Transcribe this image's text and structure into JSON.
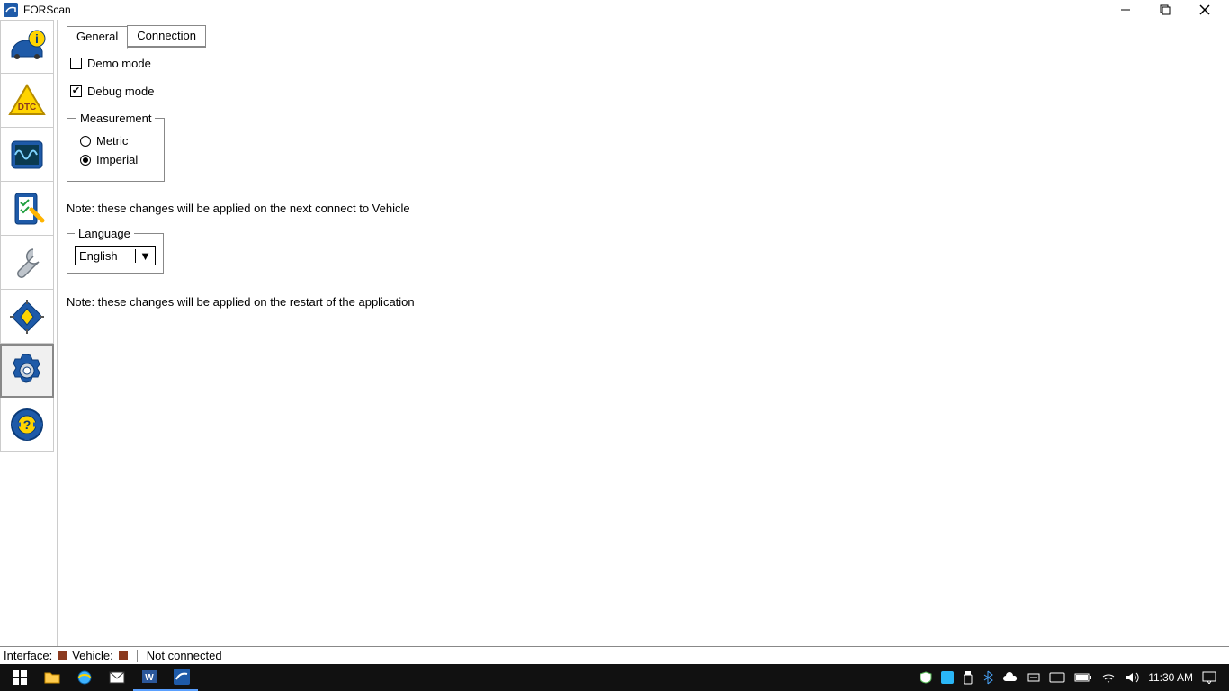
{
  "window": {
    "title": "FORScan"
  },
  "sidebar": {
    "active_index": 5
  },
  "tabs": [
    {
      "label": "General",
      "active": true
    },
    {
      "label": "Connection",
      "active": false
    }
  ],
  "options": {
    "demo_label": "Demo mode",
    "demo_checked": false,
    "debug_label": "Debug mode",
    "debug_checked": true
  },
  "measurement": {
    "legend": "Measurement",
    "metric_label": "Metric",
    "imperial_label": "Imperial",
    "selected": "imperial"
  },
  "note1": "Note: these changes will be applied on the next connect to Vehicle",
  "language": {
    "legend": "Language",
    "selected": "English"
  },
  "note2": "Note: these changes will be applied on the restart of the application",
  "status": {
    "interface_label": "Interface:",
    "vehicle_label": "Vehicle:",
    "conn_label": "Not connected"
  },
  "taskbar": {
    "time": "11:30 AM"
  }
}
